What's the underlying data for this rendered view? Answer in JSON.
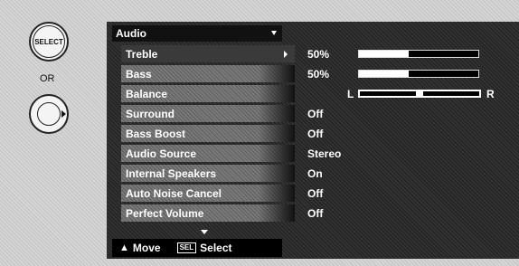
{
  "remote": {
    "select_label": "SELECT",
    "or_label": "OR"
  },
  "menu": {
    "title": "Audio",
    "items": [
      {
        "label": "Treble",
        "value": "50%",
        "level": 0.42
      },
      {
        "label": "Bass",
        "value": "50%",
        "level": 0.42
      },
      {
        "label": "Balance",
        "value": "",
        "balance_left": "L",
        "balance_right": "R",
        "balance_position": 0.5
      },
      {
        "label": "Surround",
        "value": "Off"
      },
      {
        "label": "Bass Boost",
        "value": "Off"
      },
      {
        "label": "Audio Source",
        "value": "Stereo"
      },
      {
        "label": "Internal Speakers",
        "value": "On"
      },
      {
        "label": "Auto Noise Cancel",
        "value": "Off"
      },
      {
        "label": "Perfect Volume",
        "value": "Off"
      }
    ],
    "selected_index": 0
  },
  "footer": {
    "move_label": "Move",
    "sel_key": "SEL",
    "select_label": "Select"
  }
}
